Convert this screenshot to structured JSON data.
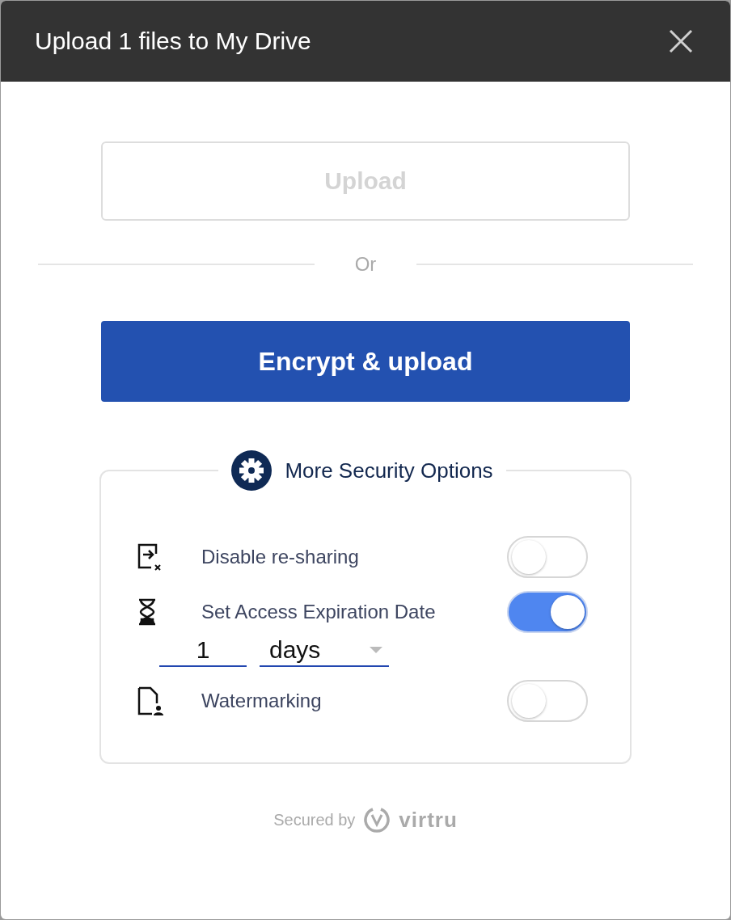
{
  "window": {
    "title": "Upload 1 files to My Drive"
  },
  "upload_button": {
    "label": "Upload",
    "disabled": true
  },
  "divider_text": "Or",
  "encrypt_button": {
    "label": "Encrypt & upload"
  },
  "security": {
    "title": "More Security Options",
    "options": [
      {
        "kind": "toggle",
        "label": "Disable re-sharing",
        "on": false
      },
      {
        "kind": "toggle",
        "label": "Set Access Expiration Date",
        "on": true,
        "expiry": {
          "number": "1",
          "unit": "days"
        }
      },
      {
        "kind": "toggle",
        "label": "Watermarking",
        "on": false
      }
    ]
  },
  "footer": {
    "text": "Secured by",
    "brand": "virtru"
  }
}
